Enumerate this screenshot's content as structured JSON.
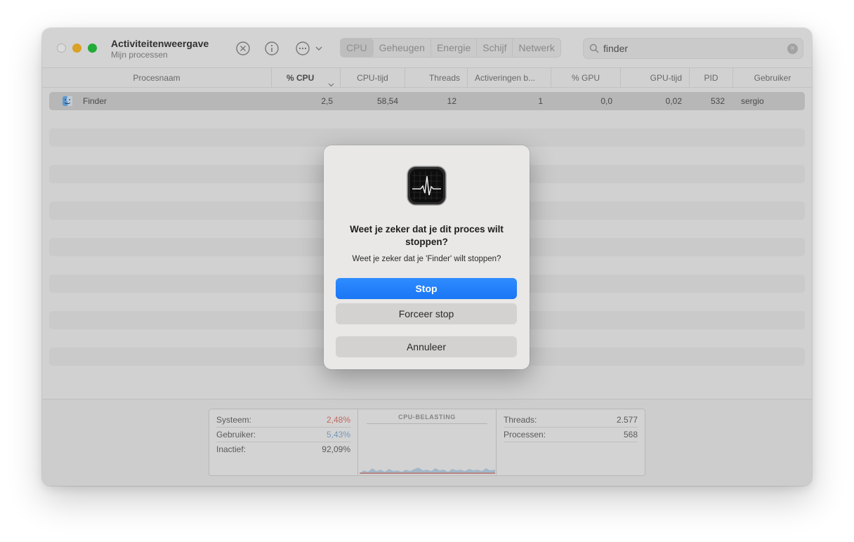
{
  "app": {
    "title": "Activiteitenweergave",
    "subtitle": "Mijn processen"
  },
  "toolbar": {
    "icons": [
      "stop-process-icon",
      "info-icon",
      "more-options-icon"
    ],
    "tabs": [
      {
        "label": "CPU",
        "active": true
      },
      {
        "label": "Geheugen",
        "active": false
      },
      {
        "label": "Energie",
        "active": false
      },
      {
        "label": "Schijf",
        "active": false
      },
      {
        "label": "Netwerk",
        "active": false
      }
    ],
    "search": {
      "value": "finder"
    }
  },
  "columns": [
    "Procesnaam",
    "% CPU",
    "CPU-tijd",
    "Threads",
    "Activeringen b...",
    "% GPU",
    "GPU-tijd",
    "PID",
    "Gebruiker"
  ],
  "rows": [
    {
      "name": "Finder",
      "cpu": "2,5",
      "cpu_time": "58,54",
      "threads": "12",
      "wakeups": "1",
      "gpu": "0,0",
      "gpu_time": "0,02",
      "pid": "532",
      "user": "sergio"
    }
  ],
  "stats": {
    "systeem": {
      "label": "Systeem:",
      "value": "2,48%"
    },
    "gebruiker": {
      "label": "Gebruiker:",
      "value": "5,43%"
    },
    "inactief": {
      "label": "Inactief:",
      "value": "92,09%"
    },
    "cpu_title": "CPU-BELASTING",
    "threads": {
      "label": "Threads:",
      "value": "2.577"
    },
    "processen": {
      "label": "Processen:",
      "value": "568"
    }
  },
  "dialog": {
    "title": "Weet je zeker dat je dit proces wilt stoppen?",
    "message": "Weet je zeker dat je 'Finder' wilt stoppen?",
    "stop": "Stop",
    "force_stop": "Forceer stop",
    "cancel": "Annuleer"
  },
  "colors": {
    "accent": "#1a76f5",
    "system_red": "#e07b70",
    "user_blue": "#8ab2d6"
  }
}
